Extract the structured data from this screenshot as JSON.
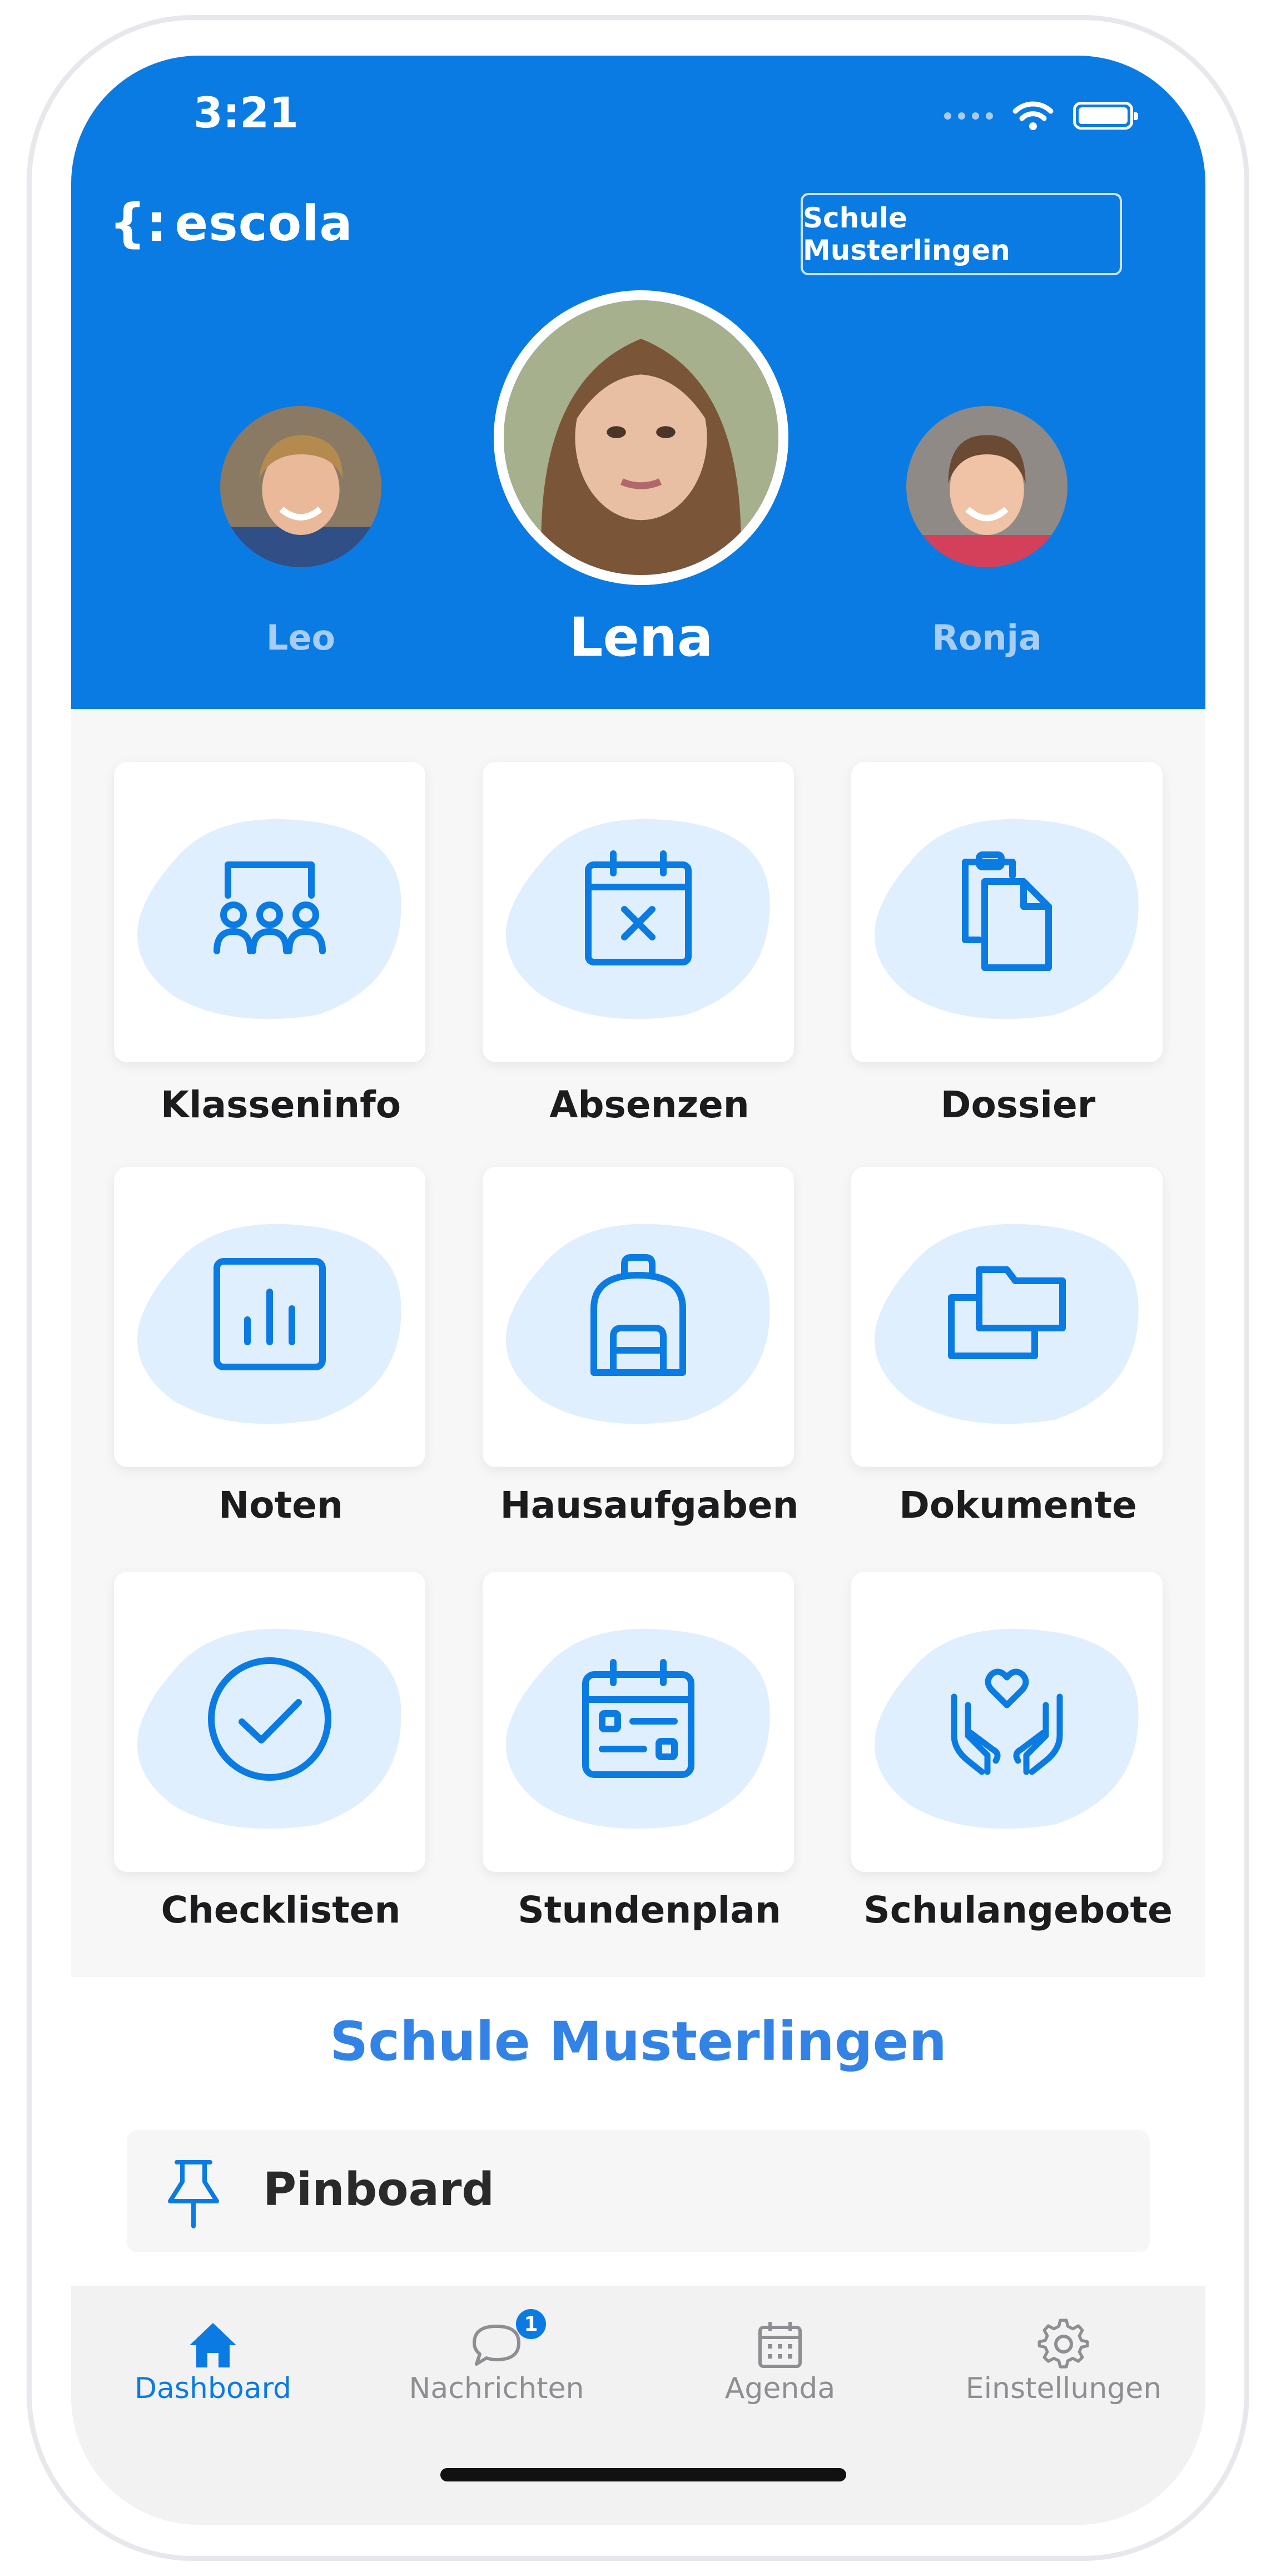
{
  "status_bar": {
    "time": "3:21"
  },
  "header": {
    "logo_text": "escola",
    "logo_mark": "{:",
    "school_button_label": "Schule Musterlingen"
  },
  "children": {
    "selected": {
      "name": "Lena"
    },
    "left": {
      "name": "Leo"
    },
    "right": {
      "name": "Ronja"
    }
  },
  "tiles": [
    {
      "label": "Klasseninfo",
      "icon": "classroom-icon"
    },
    {
      "label": "Absenzen",
      "icon": "calendar-x-icon"
    },
    {
      "label": "Dossier",
      "icon": "documents-copy-icon"
    },
    {
      "label": "Noten",
      "icon": "bar-chart-icon"
    },
    {
      "label": "Hausaufgaben",
      "icon": "backpack-icon"
    },
    {
      "label": "Dokumente",
      "icon": "folders-icon"
    },
    {
      "label": "Checklisten",
      "icon": "check-circle-icon"
    },
    {
      "label": "Stundenplan",
      "icon": "schedule-calendar-icon"
    },
    {
      "label": "Schulangebote",
      "icon": "hands-heart-icon"
    }
  ],
  "school_section": {
    "title": "Schule Musterlingen",
    "pinboard_label": "Pinboard"
  },
  "tab_bar": [
    {
      "label": "Dashboard",
      "icon": "home-icon",
      "active": true
    },
    {
      "label": "Nachrichten",
      "icon": "chat-bubble-icon",
      "badge": "1"
    },
    {
      "label": "Agenda",
      "icon": "calendar-icon"
    },
    {
      "label": "Einstellungen",
      "icon": "gear-icon"
    }
  ],
  "colors": {
    "brand_blue": "#0a7be3",
    "tile_blob": "#e0effd",
    "section_title": "#3383e6",
    "inactive_tab": "#8e8e93"
  }
}
